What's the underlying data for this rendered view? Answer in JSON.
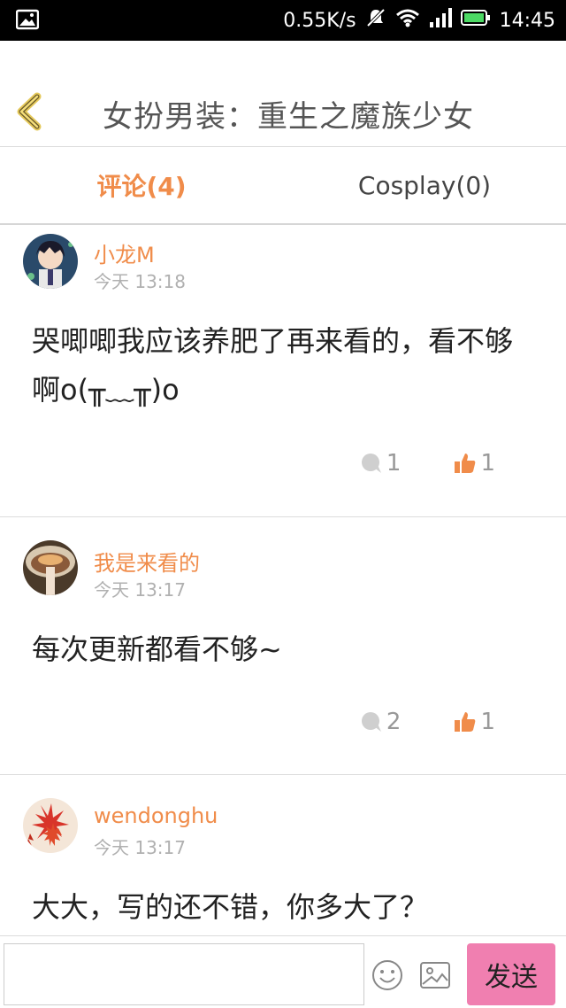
{
  "status_bar": {
    "network_speed": "0.55K/s",
    "time": "14:45",
    "icons": [
      "image-icon",
      "mute-icon",
      "wifi-icon",
      "signal-icon",
      "battery-icon"
    ]
  },
  "header": {
    "title": "女扮男装：重生之魔族少女",
    "back_icon": "chevron-left-icon"
  },
  "tabs": [
    {
      "label": "评论(4)",
      "active": true
    },
    {
      "label": "Cosplay(0)",
      "active": false
    }
  ],
  "comments": [
    {
      "username": "小龙M",
      "time": "今天 13:18",
      "text": "哭唧唧我应该养肥了再来看的，看不够啊o(╥﹏╥)o",
      "reply_count": "1",
      "like_count": "1"
    },
    {
      "username": "我是来看的",
      "time": "今天 13:17",
      "text": "每次更新都看不够~",
      "reply_count": "2",
      "like_count": "1"
    },
    {
      "username": "wendonghu",
      "time": "今天 13:17",
      "text": "大大，写的还不错，你多大了？"
    }
  ],
  "input_bar": {
    "placeholder": "",
    "send_label": "发送",
    "icons": [
      "emoji-icon",
      "image-icon"
    ]
  },
  "colors": {
    "accent": "#f08c4a",
    "send_button": "#f07fb0",
    "muted": "#b0b0b0"
  }
}
